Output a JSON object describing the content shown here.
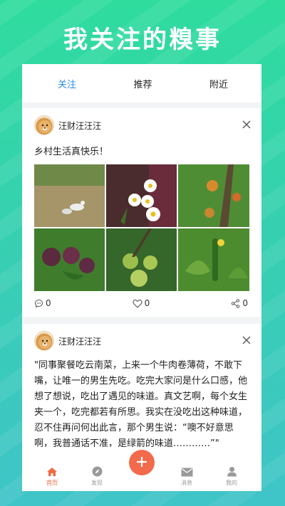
{
  "banner": {
    "title": "我关注的糗事"
  },
  "tabs": [
    {
      "label": "关注",
      "active": true
    },
    {
      "label": "推荐",
      "active": false
    },
    {
      "label": "附近",
      "active": false
    }
  ],
  "posts": [
    {
      "username": "汪财汪汪汪",
      "text": "乡村生活真快乐！",
      "photos": [
        "duck-photo",
        "daisy-photo",
        "fruit-tree-photo",
        "plum-photo",
        "green-fruit-photo",
        "cucumber-photo"
      ],
      "comments": "0",
      "likes": "0",
      "shares": "0"
    },
    {
      "username": "汪财汪汪汪",
      "text": "\"同事聚餐吃云南菜，上来一个牛肉卷薄荷，不敢下嘴，让唯一的男生先吃。吃完大家问是什么口感，他想了想说，吃出了遇见的味道。真文艺啊，每个女生夹一个，吃完都若有所思。我实在没吃出这种味道，忍不住再问何出此言，那个男生说：“噢不好意思啊，我普通话不准，是绿箭的味道…………”\""
    }
  ],
  "bottom_nav": [
    {
      "label": "首页",
      "icon": "home-icon",
      "active": true
    },
    {
      "label": "发现",
      "icon": "compass-icon",
      "active": false
    },
    {
      "label": "",
      "icon": "plus-icon",
      "active": false
    },
    {
      "label": "消息",
      "icon": "mail-icon",
      "active": false
    },
    {
      "label": "我的",
      "icon": "user-icon",
      "active": false
    }
  ],
  "colors": {
    "accent": "#2d8ee8",
    "fab": "#f26a4b",
    "nav_active": "#f06a42"
  }
}
